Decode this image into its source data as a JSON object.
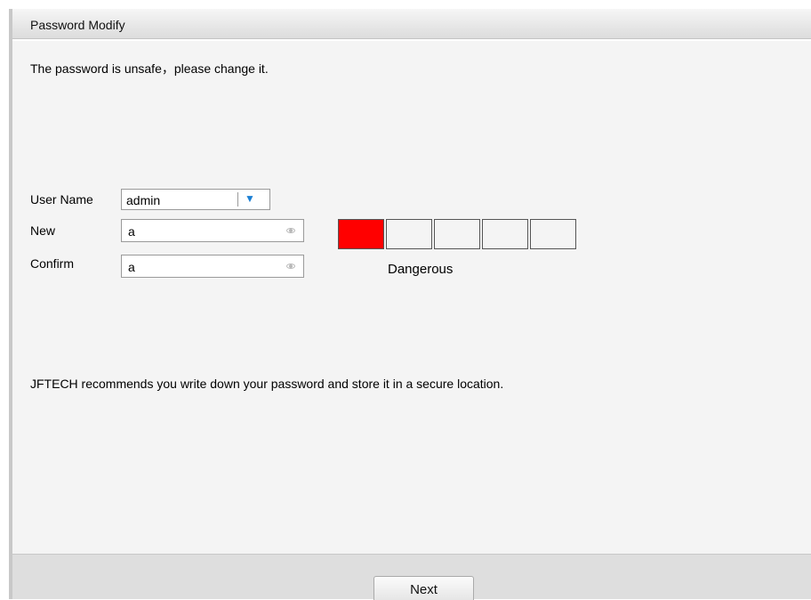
{
  "window": {
    "title": "Password Modify"
  },
  "warning": {
    "text": "The password is unsafe，please change it."
  },
  "form": {
    "user_name_label": "User Name",
    "user_name_value": "admin",
    "new_label": "New",
    "new_value": "a",
    "confirm_label": "Confirm",
    "confirm_value": "a"
  },
  "strength": {
    "level": 1,
    "segments": 5,
    "label": "Dangerous",
    "active_color": "#ff0000"
  },
  "note": {
    "text": "JFTECH recommends you write down your password and store it in a secure location."
  },
  "footer": {
    "next_label": "Next"
  },
  "icons": {
    "dropdown": "chevron-down-icon",
    "password_toggle": "eye-icon"
  },
  "colors": {
    "dropdown_arrow": "#1a7fd4"
  }
}
